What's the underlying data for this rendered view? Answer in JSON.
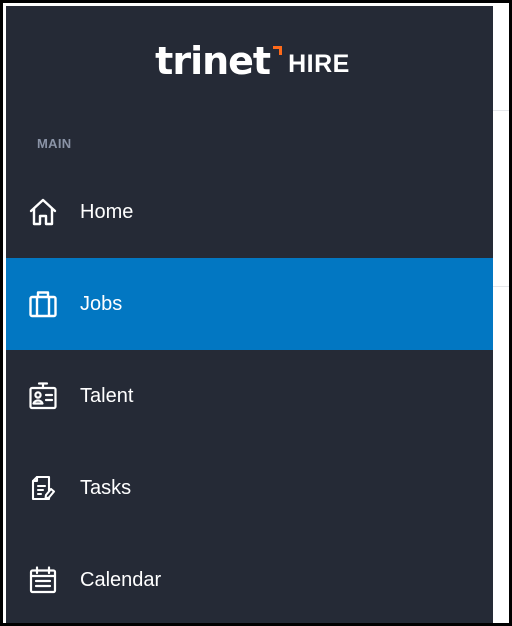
{
  "brand": {
    "logo_word": "trinet",
    "product": "HIRE",
    "accent_color": "#ff6a1a"
  },
  "sidebar": {
    "background": "#252a36",
    "active_color": "#0277c2",
    "section_label": "MAIN",
    "items": [
      {
        "label": "Home",
        "icon": "home-icon",
        "active": false
      },
      {
        "label": "Jobs",
        "icon": "briefcase-icon",
        "active": true
      },
      {
        "label": "Talent",
        "icon": "id-card-icon",
        "active": false
      },
      {
        "label": "Tasks",
        "icon": "tasks-icon",
        "active": false
      },
      {
        "label": "Calendar",
        "icon": "calendar-icon",
        "active": false
      }
    ]
  }
}
